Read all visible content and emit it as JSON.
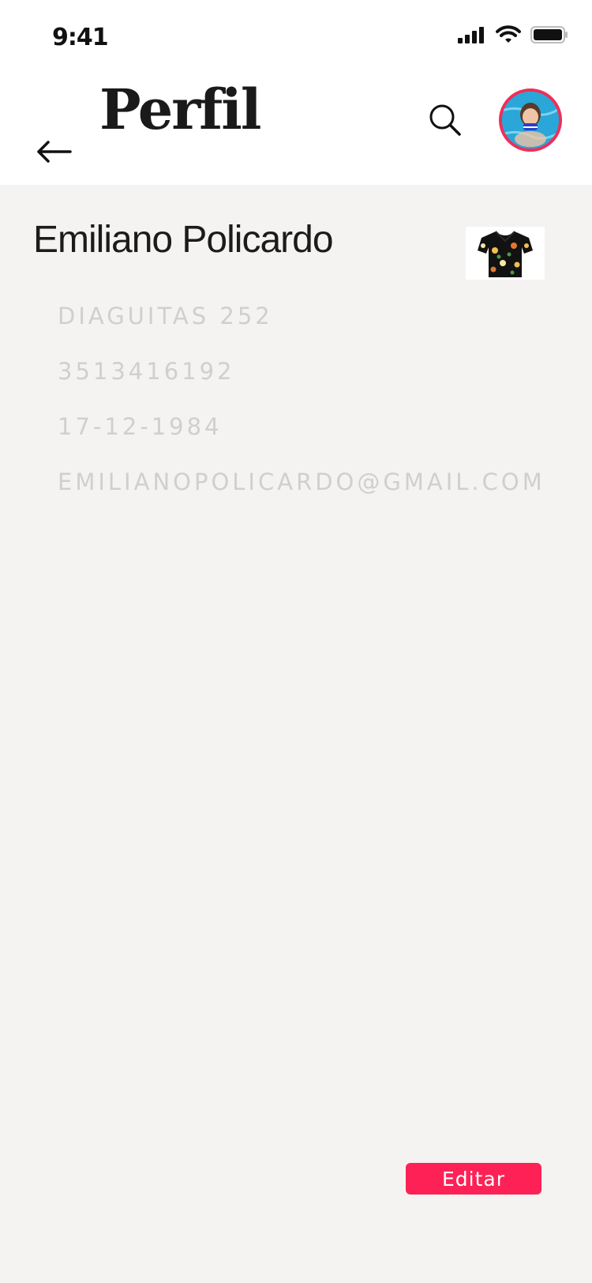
{
  "status_bar": {
    "time": "9:41",
    "icons": [
      "signal-icon",
      "wifi-icon",
      "battery-icon"
    ]
  },
  "header": {
    "title": "Perfil",
    "back_icon": "arrow-left-icon",
    "search_icon": "search-icon",
    "avatar_icon": "profile-photo"
  },
  "profile": {
    "name": "Emiliano Policardo",
    "address": "DIAGUITAS 252",
    "phone": "3513416192",
    "birthdate": "17-12-1984",
    "email": "EMILIANOPOLICARDO@GMAIL.COM"
  },
  "actions": {
    "edit_label": "Editar"
  },
  "colors": {
    "accent": "#fe2156",
    "avatar_ring": "#ef2e59",
    "background": "#f4f3f2",
    "header_background": "#ffffff",
    "muted_text": "#cfcfcf"
  }
}
